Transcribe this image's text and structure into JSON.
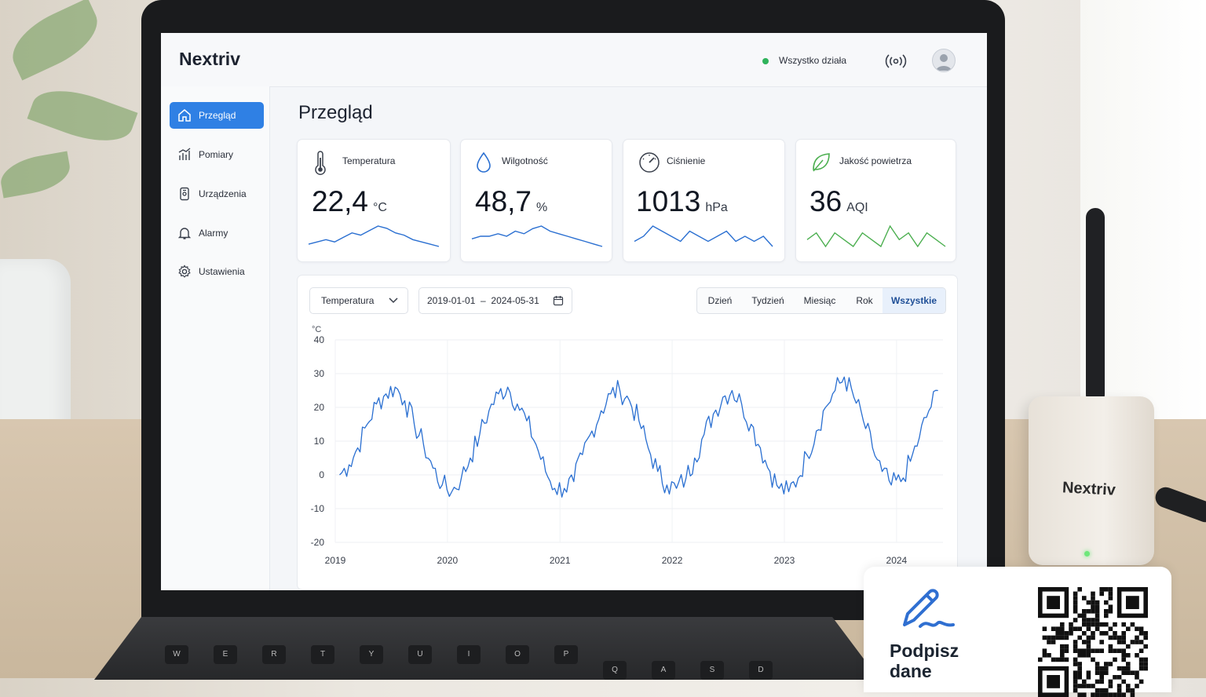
{
  "app": {
    "brand": "Nextriv",
    "status_text": "Wszystko działa",
    "status_color": "#2fb35b",
    "accent": "#2f80e4"
  },
  "sidebar": {
    "items": [
      {
        "label": "Przegląd",
        "icon": "home-icon",
        "active": true
      },
      {
        "label": "Pomiary",
        "icon": "bar-chart-icon",
        "active": false
      },
      {
        "label": "Urządzenia",
        "icon": "device-icon",
        "active": false
      },
      {
        "label": "Alarmy",
        "icon": "bell-icon",
        "active": false
      },
      {
        "label": "Ustawienia",
        "icon": "gear-icon",
        "active": false
      }
    ]
  },
  "main": {
    "title": "Przegląd",
    "cards": [
      {
        "title": "Temperatura",
        "value": "22,4",
        "unit": "°C",
        "icon": "thermometer-icon",
        "color": "#2a6fd1"
      },
      {
        "title": "Wilgotność",
        "value": "48,7",
        "unit": "%",
        "icon": "droplet-icon",
        "color": "#2a6fd1"
      },
      {
        "title": "Ciśnienie",
        "value": "1013",
        "unit": "hPa",
        "icon": "gauge-icon",
        "color": "#2a6fd1"
      },
      {
        "title": "Jakość powietrza",
        "value": "36",
        "unit": "AQI",
        "icon": "leaf-icon",
        "color": "#4caf50"
      }
    ],
    "controls": {
      "metric_select": "Temperatura",
      "date_range": "2019-01-01  –  2024-05-31",
      "ranges": [
        "Dzień",
        "Tydzień",
        "Miesiąc",
        "Rok",
        "Wszystkie"
      ],
      "active_range": "Wszystkie"
    }
  },
  "chart_data": {
    "type": "line",
    "ylabel": "°C",
    "ylim": [
      -20,
      40
    ],
    "yticks": [
      40,
      30,
      20,
      10,
      0,
      -10,
      -20
    ],
    "x_tick_labels": [
      "2019",
      "2020",
      "2021",
      "2022",
      "2023",
      "2024"
    ],
    "x_range": [
      "2019-01-01",
      "2024-05-31"
    ],
    "grid": true,
    "series": [
      {
        "color": "#2a6fd1",
        "x": [
          "2019-01",
          "2019-02",
          "2019-03",
          "2019-04",
          "2019-05",
          "2019-06",
          "2019-07",
          "2019-08",
          "2019-09",
          "2019-10",
          "2019-11",
          "2019-12",
          "2020-01",
          "2020-02",
          "2020-03",
          "2020-04",
          "2020-05",
          "2020-06",
          "2020-07",
          "2020-08",
          "2020-09",
          "2020-10",
          "2020-11",
          "2020-12",
          "2021-01",
          "2021-02",
          "2021-03",
          "2021-04",
          "2021-05",
          "2021-06",
          "2021-07",
          "2021-08",
          "2021-09",
          "2021-10",
          "2021-11",
          "2021-12",
          "2022-01",
          "2022-02",
          "2022-03",
          "2022-04",
          "2022-05",
          "2022-06",
          "2022-07",
          "2022-08",
          "2022-09",
          "2022-10",
          "2022-11",
          "2022-12",
          "2023-01",
          "2023-02",
          "2023-03",
          "2023-04",
          "2023-05",
          "2023-06",
          "2023-07",
          "2023-08",
          "2023-09",
          "2023-10",
          "2023-11",
          "2023-12",
          "2024-01",
          "2024-02",
          "2024-03",
          "2024-04",
          "2024-05"
        ],
        "values": [
          0,
          3,
          8,
          15,
          21,
          24,
          26,
          22,
          15,
          9,
          2,
          -3,
          -5,
          -1,
          5,
          12,
          19,
          24,
          26,
          21,
          16,
          9,
          1,
          -4,
          -4,
          -2,
          6,
          13,
          19,
          24,
          25,
          22,
          16,
          8,
          1,
          -3,
          -4,
          -1,
          5,
          12,
          18,
          23,
          25,
          21,
          15,
          8,
          1,
          -4,
          -5,
          -1,
          6,
          13,
          20,
          25,
          29,
          23,
          16,
          8,
          1,
          -3,
          -2,
          4,
          11,
          19,
          25
        ]
      }
    ]
  },
  "sparklines": {
    "temperature": [
      4,
      5,
      6,
      5,
      7,
      9,
      8,
      10,
      12,
      11,
      9,
      8,
      6,
      5,
      4,
      3
    ],
    "humidity": [
      3,
      4,
      4,
      5,
      4,
      6,
      5,
      7,
      8,
      6,
      5,
      4,
      3,
      2,
      1,
      0
    ],
    "pressure": [
      6,
      7,
      9,
      8,
      7,
      6,
      8,
      7,
      6,
      7,
      8,
      6,
      7,
      6,
      7,
      5
    ],
    "aqi": [
      5,
      6,
      4,
      6,
      5,
      4,
      6,
      5,
      4,
      7,
      5,
      6,
      4,
      6,
      5,
      4
    ]
  },
  "overlay": {
    "label": "Podpisz dane",
    "pen_icon": "signature-pen-icon",
    "qr_icon": "qr-code-icon"
  },
  "device": {
    "label": "Nextriv"
  },
  "keyboard": {
    "keys": [
      "W",
      "E",
      "R",
      "T",
      "Y",
      "U",
      "I",
      "O",
      "P",
      "Q",
      "A",
      "S",
      "D"
    ]
  }
}
